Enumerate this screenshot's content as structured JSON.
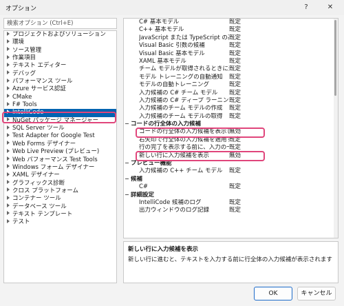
{
  "window": {
    "title": "オプション",
    "help": "?",
    "close": "✕"
  },
  "search": {
    "placeholder": "検索オプション (Ctrl+E)"
  },
  "tree": {
    "items": [
      {
        "label": "プロジェクトおよびソリューション"
      },
      {
        "label": "環境"
      },
      {
        "label": "ソース管理"
      },
      {
        "label": "作業項目"
      },
      {
        "label": "テキスト エディター"
      },
      {
        "label": "デバッグ"
      },
      {
        "label": "パフォーマンス ツール"
      },
      {
        "label": "Azure サービス認証"
      },
      {
        "label": "CMake"
      },
      {
        "label": "F# Tools"
      },
      {
        "label": "IntelliCode",
        "selected": true
      },
      {
        "label": "NuGet パッケージ マネージャー"
      },
      {
        "label": "SQL Server ツール"
      },
      {
        "label": "Test Adapter for Google Test"
      },
      {
        "label": "Web Forms デザイナー"
      },
      {
        "label": "Web Live Preview (プレビュー)"
      },
      {
        "label": "Web パフォーマンス Test Tools"
      },
      {
        "label": "Windows フォーム デザイナー"
      },
      {
        "label": "XAML デザイナー"
      },
      {
        "label": "グラフィックス診断"
      },
      {
        "label": "クロス プラットフォーム"
      },
      {
        "label": "コンテナー ツール"
      },
      {
        "label": "データベース ツール"
      },
      {
        "label": "テキスト テンプレート"
      },
      {
        "label": "テスト"
      }
    ]
  },
  "grid": {
    "rows": [
      {
        "name": "C# 基本モデル",
        "value": "既定"
      },
      {
        "name": "C++ 基本モデル",
        "value": "既定"
      },
      {
        "name": "JavaScript または TypeScript の基本モデル",
        "value": "既定"
      },
      {
        "name": "Visual Basic 引数の候補",
        "value": "既定"
      },
      {
        "name": "Visual Basic 基本モデル",
        "value": "既定"
      },
      {
        "name": "XAML 基本モデル",
        "value": "既定"
      },
      {
        "name": "チーム モデルが取得されるときに通知する",
        "value": "既定"
      },
      {
        "name": "モデル トレーニングの自動通知",
        "value": "既定"
      },
      {
        "name": "モデルの自動トレーニング",
        "value": "既定"
      },
      {
        "name": "入力候補の C# チーム モデル",
        "value": "既定"
      },
      {
        "name": "入力候補の C# ディープ ラーニング基本モデル",
        "value": "既定"
      },
      {
        "name": "入力候補のチーム モデルの作成",
        "value": "既定"
      },
      {
        "name": "入力候補のチーム モデルの取得",
        "value": "既定"
      },
      {
        "name": "コードの行全体の入力候補",
        "category": true
      },
      {
        "name": "コードの行全体の入力候補を表示します",
        "value": "無効"
      },
      {
        "name": "右矢印で行全体の入力候補を適用する",
        "value": "既定"
      },
      {
        "name": "行の完了を表示する前に、入力の一時停止を待つ",
        "value": "既定"
      },
      {
        "name": "新しい行に入力候補を表示",
        "value": "無効"
      },
      {
        "name": "プレビュー機能",
        "category": true
      },
      {
        "name": "入力候補の C++ チーム モデル",
        "value": "既定"
      },
      {
        "name": "候補",
        "category": true
      },
      {
        "name": "C#",
        "value": "既定"
      },
      {
        "name": "詳細設定",
        "category": true
      },
      {
        "name": "IntelliCode 候補のログ",
        "value": "既定"
      },
      {
        "name": "出力ウィンドウのログ記録",
        "value": "既定"
      }
    ]
  },
  "description": {
    "title": "新しい行に入力候補を表示",
    "text": "新しい行に進むと、テキストを入力する前に行全体の入力候補が表示されます"
  },
  "buttons": {
    "ok": "OK",
    "cancel": "キャンセル"
  }
}
